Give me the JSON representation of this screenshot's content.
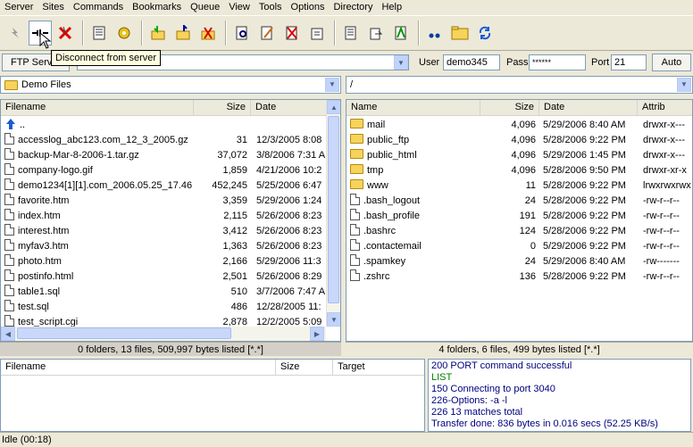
{
  "menu": [
    "Server",
    "Sites",
    "Commands",
    "Bookmarks",
    "Queue",
    "View",
    "Tools",
    "Options",
    "Directory",
    "Help"
  ],
  "tooltip": "Disconnect from server",
  "connection": {
    "ftp_server_label": "FTP Server",
    "user_label": "User",
    "user_value": "demo345",
    "pass_label": "Pass",
    "pass_value": "******",
    "port_label": "Port",
    "port_value": "21",
    "auto_label": "Auto"
  },
  "local": {
    "path": "Demo Files",
    "headers": {
      "filename": "Filename",
      "size": "Size",
      "date": "Date"
    },
    "parent": "..",
    "files": [
      {
        "name": "accesslog_abc123.com_12_3_2005.gz",
        "size": "31",
        "date": "12/3/2005 8:08"
      },
      {
        "name": "backup-Mar-8-2006-1.tar.gz",
        "size": "37,072",
        "date": "3/8/2006 7:31 A"
      },
      {
        "name": "company-logo.gif",
        "size": "1,859",
        "date": "4/21/2006 10:2"
      },
      {
        "name": "demo1234[1][1].com_2006.05.25_17.46",
        "size": "452,245",
        "date": "5/25/2006 6:47"
      },
      {
        "name": "favorite.htm",
        "size": "3,359",
        "date": "5/29/2006 1:24"
      },
      {
        "name": "index.htm",
        "size": "2,115",
        "date": "5/26/2006 8:23"
      },
      {
        "name": "interest.htm",
        "size": "3,412",
        "date": "5/26/2006 8:23"
      },
      {
        "name": "myfav3.htm",
        "size": "1,363",
        "date": "5/26/2006 8:23"
      },
      {
        "name": "photo.htm",
        "size": "2,166",
        "date": "5/29/2006 11:3"
      },
      {
        "name": "postinfo.html",
        "size": "2,501",
        "date": "5/26/2006 8:29"
      },
      {
        "name": "table1.sql",
        "size": "510",
        "date": "3/7/2006 7:47 A"
      },
      {
        "name": "test.sql",
        "size": "486",
        "date": "12/28/2005 11:"
      },
      {
        "name": "test_script.cgi",
        "size": "2,878",
        "date": "12/2/2005 5:09"
      }
    ],
    "status": "0 folders, 13 files, 509,997 bytes listed [*.*]"
  },
  "remote": {
    "path": "/",
    "headers": {
      "name": "Name",
      "size": "Size",
      "date": "Date",
      "attrib": "Attrib"
    },
    "files": [
      {
        "name": "mail",
        "type": "folder",
        "size": "4,096",
        "date": "5/29/2006 8:40 AM",
        "attrib": "drwxr-x---"
      },
      {
        "name": "public_ftp",
        "type": "folder",
        "size": "4,096",
        "date": "5/28/2006 9:22 PM",
        "attrib": "drwxr-x---"
      },
      {
        "name": "public_html",
        "type": "folder",
        "size": "4,096",
        "date": "5/29/2006 1:45 PM",
        "attrib": "drwxr-x---"
      },
      {
        "name": "tmp",
        "type": "folder",
        "size": "4,096",
        "date": "5/28/2006 9:50 PM",
        "attrib": "drwxr-xr-x"
      },
      {
        "name": "www",
        "type": "link",
        "size": "11",
        "date": "5/28/2006 9:22 PM",
        "attrib": "lrwxrwxrwx"
      },
      {
        "name": ".bash_logout",
        "type": "file",
        "size": "24",
        "date": "5/28/2006 9:22 PM",
        "attrib": "-rw-r--r--"
      },
      {
        "name": ".bash_profile",
        "type": "file",
        "size": "191",
        "date": "5/28/2006 9:22 PM",
        "attrib": "-rw-r--r--"
      },
      {
        "name": ".bashrc",
        "type": "file",
        "size": "124",
        "date": "5/28/2006 9:22 PM",
        "attrib": "-rw-r--r--"
      },
      {
        "name": ".contactemail",
        "type": "file",
        "size": "0",
        "date": "5/29/2006 9:22 PM",
        "attrib": "-rw-r--r--"
      },
      {
        "name": ".spamkey",
        "type": "file",
        "size": "24",
        "date": "5/29/2006 8:40 AM",
        "attrib": "-rw-------"
      },
      {
        "name": ".zshrc",
        "type": "file",
        "size": "136",
        "date": "5/28/2006 9:22 PM",
        "attrib": "-rw-r--r--"
      }
    ],
    "status": "4 folders, 6 files, 499 bytes listed [*.*]"
  },
  "queue": {
    "headers": {
      "filename": "Filename",
      "size": "Size",
      "target": "Target"
    }
  },
  "log": [
    {
      "text": "200 PORT command successful",
      "color": "#000080"
    },
    {
      "text": "LIST",
      "color": "#008000"
    },
    {
      "text": "150 Connecting to port 3040",
      "color": "#000080"
    },
    {
      "text": "226-Options: -a -l",
      "color": "#000080"
    },
    {
      "text": "226 13 matches total",
      "color": "#000080"
    },
    {
      "text": "Transfer done: 836 bytes in 0.016 secs (52.25 KB/s)",
      "color": "#000080"
    }
  ],
  "statusbar": "Idle (00:18)"
}
